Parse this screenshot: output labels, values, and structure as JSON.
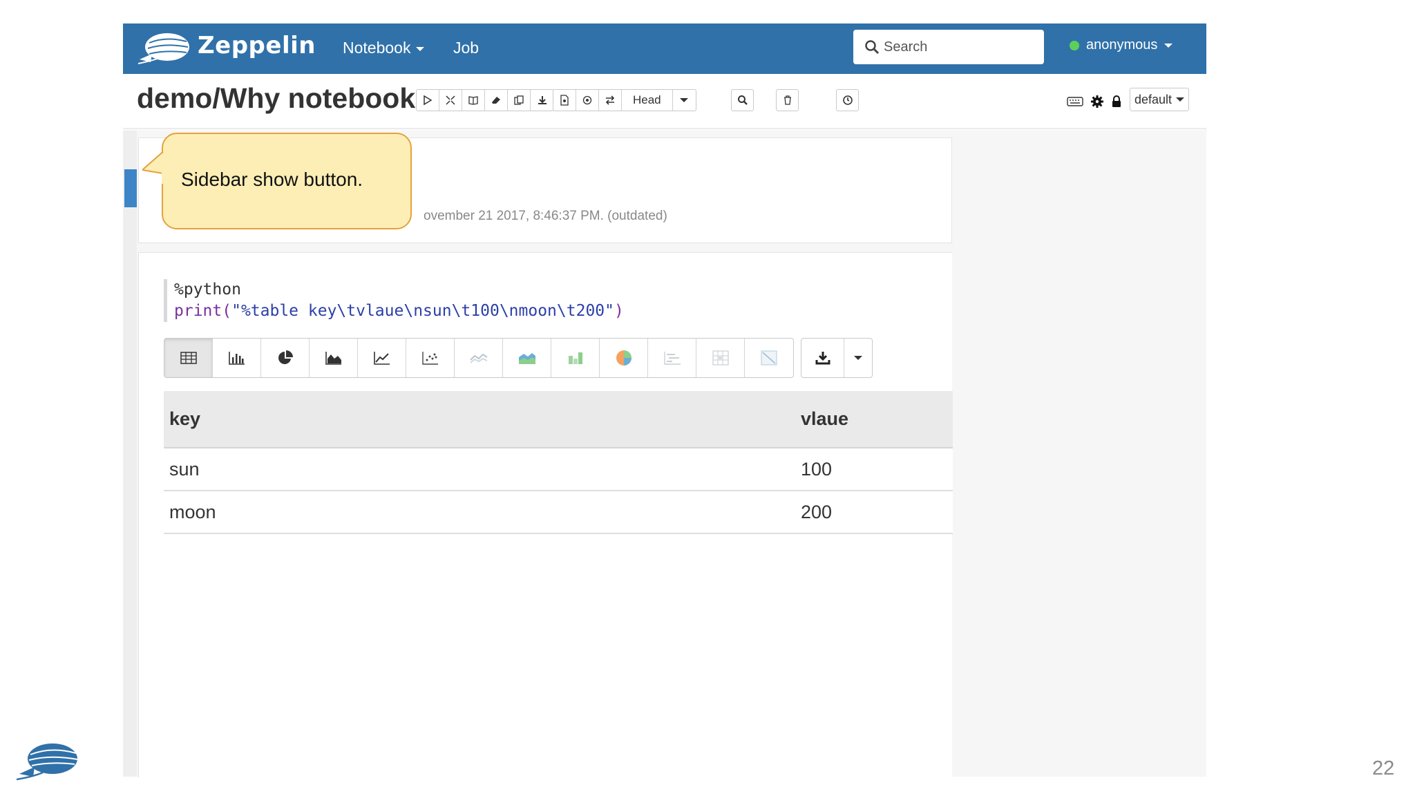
{
  "navbar": {
    "brand": "Zeppelin",
    "notebook_label": "Notebook",
    "job_label": "Job",
    "search_placeholder": "Search",
    "user": "anonymous"
  },
  "notebook": {
    "title": "demo/Why notebook",
    "head_label": "Head",
    "interpreter_binding": "default"
  },
  "paragraph1": {
    "status_text": "ovember 21 2017, 8:46:37 PM. (outdated)"
  },
  "paragraph2": {
    "code_line1": "%python",
    "code_line2_fn": "print(",
    "code_line2_str": "\"%table key\\tvlaue\\nsun\\t100\\nmoon\\t200\"",
    "code_line2_end": ")",
    "table": {
      "headers": [
        "key",
        "vlaue"
      ],
      "rows": [
        [
          "sun",
          "100"
        ],
        [
          "moon",
          "200"
        ]
      ]
    }
  },
  "callout": {
    "text": "Sidebar show button."
  },
  "slide": {
    "page_number": "22"
  },
  "colors": {
    "navbar": "#3071a9",
    "sidebar_button": "#3d85c6",
    "callout_fill": "#fdeeb6",
    "callout_border": "#e3a23b"
  }
}
